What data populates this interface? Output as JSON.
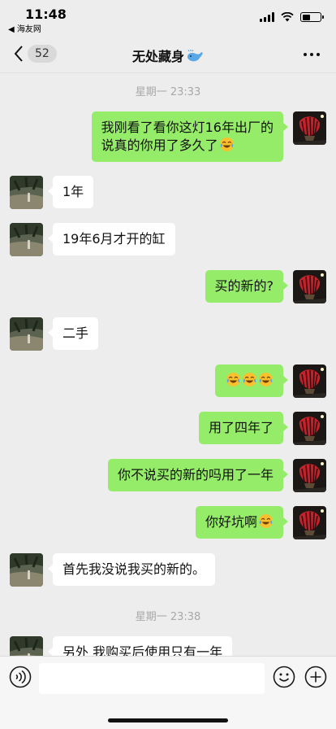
{
  "status_bar": {
    "time": "11:48",
    "back_app": "◀ 海友网",
    "battery_level": 0.45
  },
  "nav": {
    "unread_count": "52",
    "title": "无处藏身"
  },
  "messages": [
    {
      "type": "timestamp",
      "text": "星期一 23:33"
    },
    {
      "type": "me",
      "lines": [
        "我刚看了看你这灯16年出厂的",
        "说真的你用了多久了"
      ],
      "emoji": "laughing-tears"
    },
    {
      "type": "other",
      "text": "1年"
    },
    {
      "type": "other",
      "text": "19年6月才开的缸"
    },
    {
      "type": "me",
      "text": "买的新的?"
    },
    {
      "type": "other",
      "text": "二手"
    },
    {
      "type": "me",
      "emoji_only": [
        "laughing-tears",
        "laughing-tears",
        "laughing-tears"
      ]
    },
    {
      "type": "me",
      "text": "用了四年了"
    },
    {
      "type": "me",
      "text": "你不说买的新的吗用了一年"
    },
    {
      "type": "me",
      "text": "你好坑啊",
      "emoji": "laughing-tears"
    },
    {
      "type": "other",
      "text": "首先我没说我买的新的。"
    },
    {
      "type": "timestamp",
      "text": "星期一 23:38"
    },
    {
      "type": "other",
      "text": "另外 我购买后使用只有一年"
    }
  ],
  "input": {
    "value": "",
    "placeholder": ""
  },
  "colors": {
    "me_bubble": "#95ec69",
    "other_bubble": "#ffffff",
    "background": "#ededed"
  }
}
